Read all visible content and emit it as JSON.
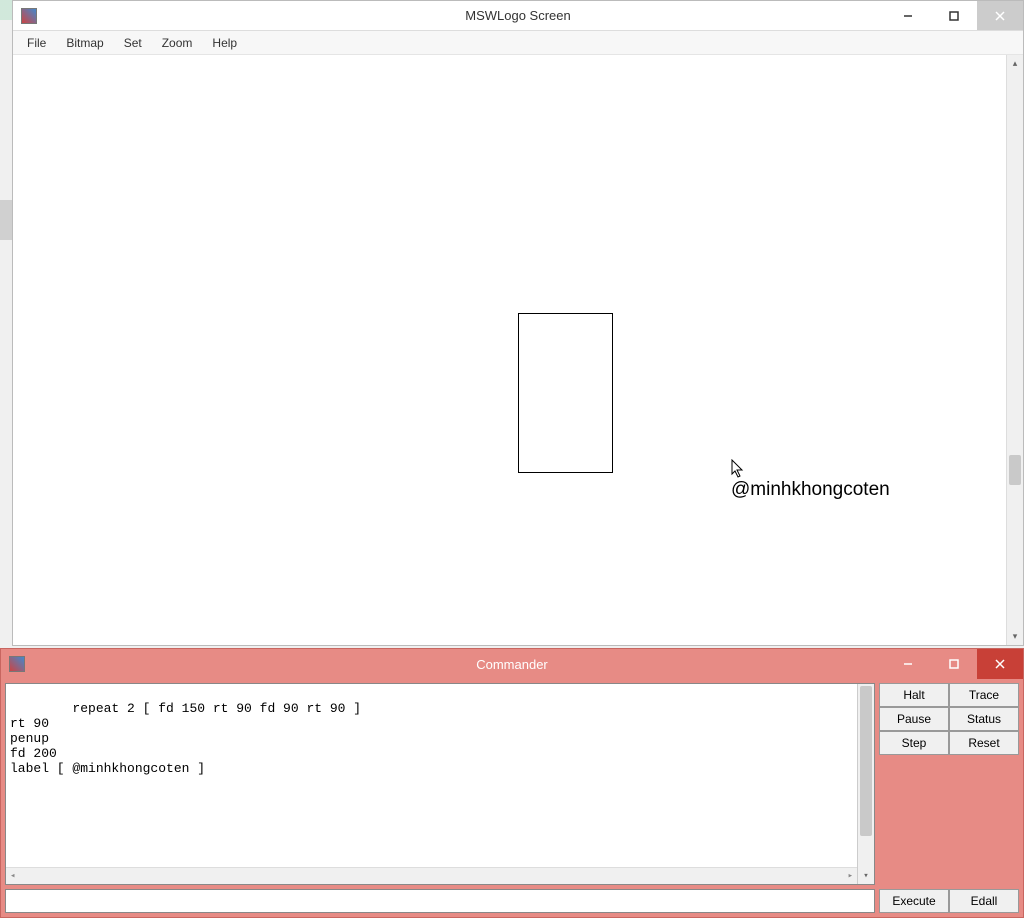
{
  "main_window": {
    "title": "MSWLogo Screen",
    "menu": [
      "File",
      "Bitmap",
      "Set",
      "Zoom",
      "Help"
    ],
    "canvas_label": "@minhkhongcoten"
  },
  "commander": {
    "title": "Commander",
    "history": "repeat 2 [ fd 150 rt 90 fd 90 rt 90 ]\nrt 90\npenup\nfd 200\nlabel [ @minhkhongcoten ]",
    "input_value": "",
    "buttons": {
      "halt": "Halt",
      "trace": "Trace",
      "pause": "Pause",
      "status": "Status",
      "step": "Step",
      "reset": "Reset",
      "execute": "Execute",
      "edall": "Edall"
    }
  }
}
